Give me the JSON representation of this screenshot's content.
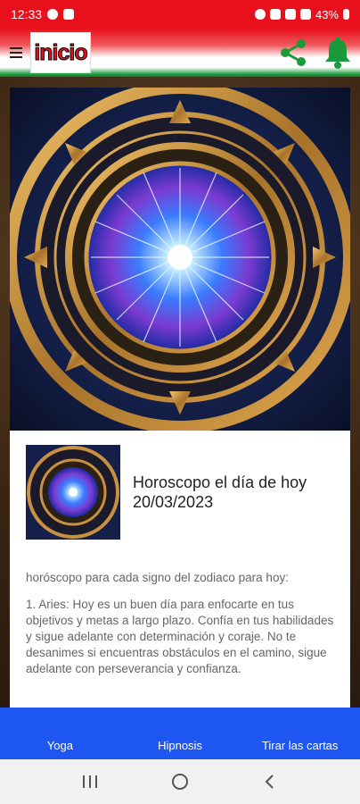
{
  "status": {
    "time": "12:33",
    "battery": "43%"
  },
  "app_bar": {
    "logo_text": "inicio"
  },
  "article": {
    "title": "Horoscopo el día de hoy 20/03/2023",
    "intro": "horóscopo para cada signo del zodiaco para hoy:",
    "aries": "1. Aries: Hoy es un buen día para enfocarte en tus objetivos y metas a largo plazo. Confía en tus habilidades y sigue adelante con determinación y coraje. No te desanimes si encuentras obstáculos en el camino, sigue adelante con perseverancia y confianza."
  },
  "bottom_nav": {
    "items": [
      {
        "label": "Yoga"
      },
      {
        "label": "Hipnosis"
      },
      {
        "label": "Tirar las cartas"
      }
    ]
  },
  "colors": {
    "status_red": "#e8111b",
    "nav_blue": "#1d56f0",
    "brand_green": "#1a9a3a"
  },
  "icons": {
    "share": "share-icon",
    "bell": "bell-icon",
    "menu": "menu-icon"
  }
}
